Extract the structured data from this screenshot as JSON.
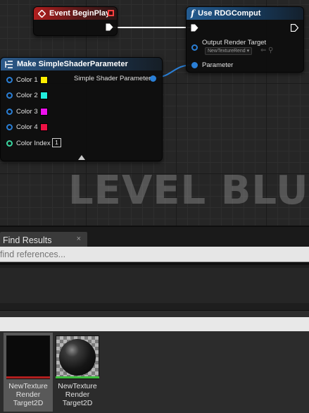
{
  "graph": {
    "watermark": "LEVEL BLUEP",
    "nodes": {
      "event_begin_play": {
        "title": "Event BeginPlay"
      },
      "use_rdg_compute": {
        "title": "Use RDGComput",
        "func_icon": "f",
        "output_render_target_label": "Output Render Target",
        "render_target_value": "NewTextureRend",
        "parameter_label": "Parameter"
      },
      "make_simple_shader_parameter": {
        "title": "Make SimpleShaderParameter",
        "output_label": "Simple Shader Parameter",
        "inputs": [
          {
            "label": "Color 1",
            "color": "#ffee00"
          },
          {
            "label": "Color 2",
            "color": "#22eedd"
          },
          {
            "label": "Color 3",
            "color": "#ee11ee"
          },
          {
            "label": "Color 4",
            "color": "#ee1144"
          }
        ],
        "color_index_label": "Color Index",
        "color_index_value": "1"
      }
    }
  },
  "find_results": {
    "tab_label": "Find Results",
    "close_glyph": "×",
    "search_placeholder": "find references..."
  },
  "assets": [
    {
      "label": "NewTexture Render Target2D",
      "thumbnail": "black-render-target",
      "accent": "#b01e1e"
    },
    {
      "label": "NewTexture Render Target2D",
      "thumbnail": "dark-sphere",
      "accent": "#3cbf3c"
    }
  ],
  "colors": {
    "event_header": "#b01e1e",
    "function_header": "#245c91",
    "exec_wire": "#ffffff",
    "data_wire": "#2a7fd6"
  }
}
